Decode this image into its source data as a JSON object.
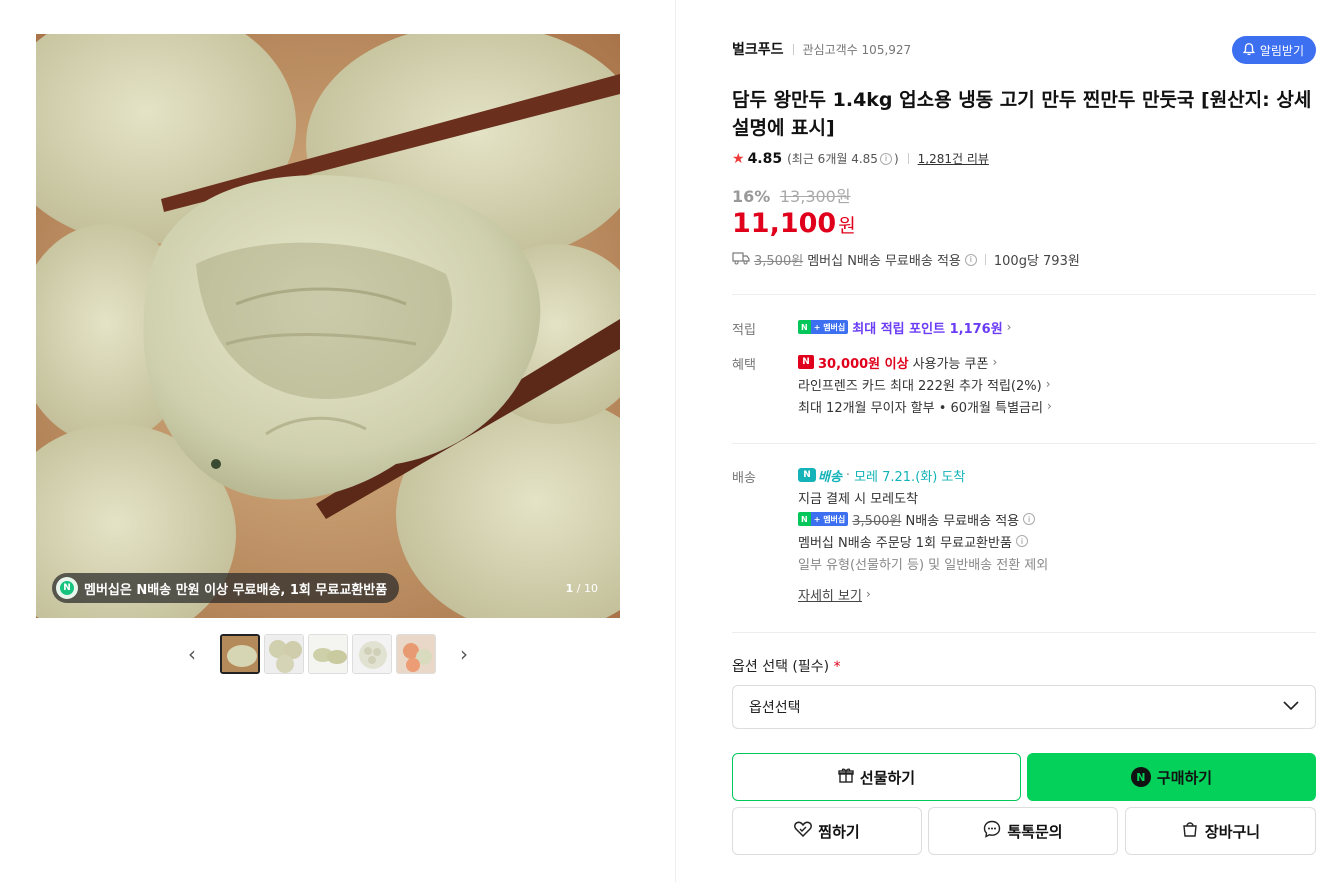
{
  "gallery": {
    "promo_text": "멤버십은 N배송 만원 이상 무료배송, 1회 무료교환반품",
    "counter_current": "1",
    "counter_total": "/ 10",
    "prev_icon": "chevron-left-icon",
    "next_icon": "chevron-right-icon",
    "thumb_count": 5
  },
  "seller": {
    "name": "벌크푸드",
    "followers_label": "관심고객수 105,927",
    "alarm_label": "알림받기"
  },
  "product": {
    "title": "담두 왕만두 1.4kg 업소용 냉동 고기 만두 찐만두 만둣국 [원산지: 상세설명에 표시]",
    "rating": "4.85",
    "recent_rating": "(최근 6개월 4.85",
    "recent_rating_close": ")",
    "review_link": "1,281건 리뷰",
    "discount": "16%",
    "original_price": "13,300원",
    "price": "11,100",
    "price_unit": "원",
    "shipping_fee_strike": "3,500원",
    "shipping_note": "멤버십 N배송 무료배송 적용",
    "unit_price": "100g당 793원"
  },
  "points": {
    "label": "적립",
    "badge_n": "N",
    "badge_plus": "+ 멤버십",
    "text": "최대 적립 포인트 1,176원"
  },
  "benefits": {
    "label": "혜택",
    "coupon_badge": "N",
    "coupon_amount": "30,000원 이상",
    "coupon_text": "사용가능 쿠폰",
    "card_text": "라인프렌즈 카드 최대 222원 추가 적립(2%)",
    "installment_text": "최대 12개월 무이자 할부 • 60개월 특별금리"
  },
  "delivery": {
    "label": "배송",
    "n_delivery": "배송",
    "arrival": "모레 7.21.(화) 도착",
    "pay_note": "지금 결제 시 모레도착",
    "fee_strike": "3,500원",
    "fee_note": "N배송 무료배송 적용",
    "exchange_note": "멤버십 N배송 주문당 1회 무료교환반품",
    "exclusion_note": "일부 유형(선물하기 등) 및 일반배송 전환 제외",
    "details_link": "자세히 보기"
  },
  "options": {
    "label": "옵션 선택 (필수)",
    "required_mark": "*",
    "select_value": "옵션선택"
  },
  "actions": {
    "gift": "선물하기",
    "buy": "구매하기",
    "wish": "찜하기",
    "talk": "톡톡문의",
    "cart": "장바구니"
  },
  "colors": {
    "price_red": "#e0001b",
    "naver_green": "#03c75a",
    "alarm_blue": "#3d6ff1",
    "point_purple": "#6b3cf5"
  }
}
